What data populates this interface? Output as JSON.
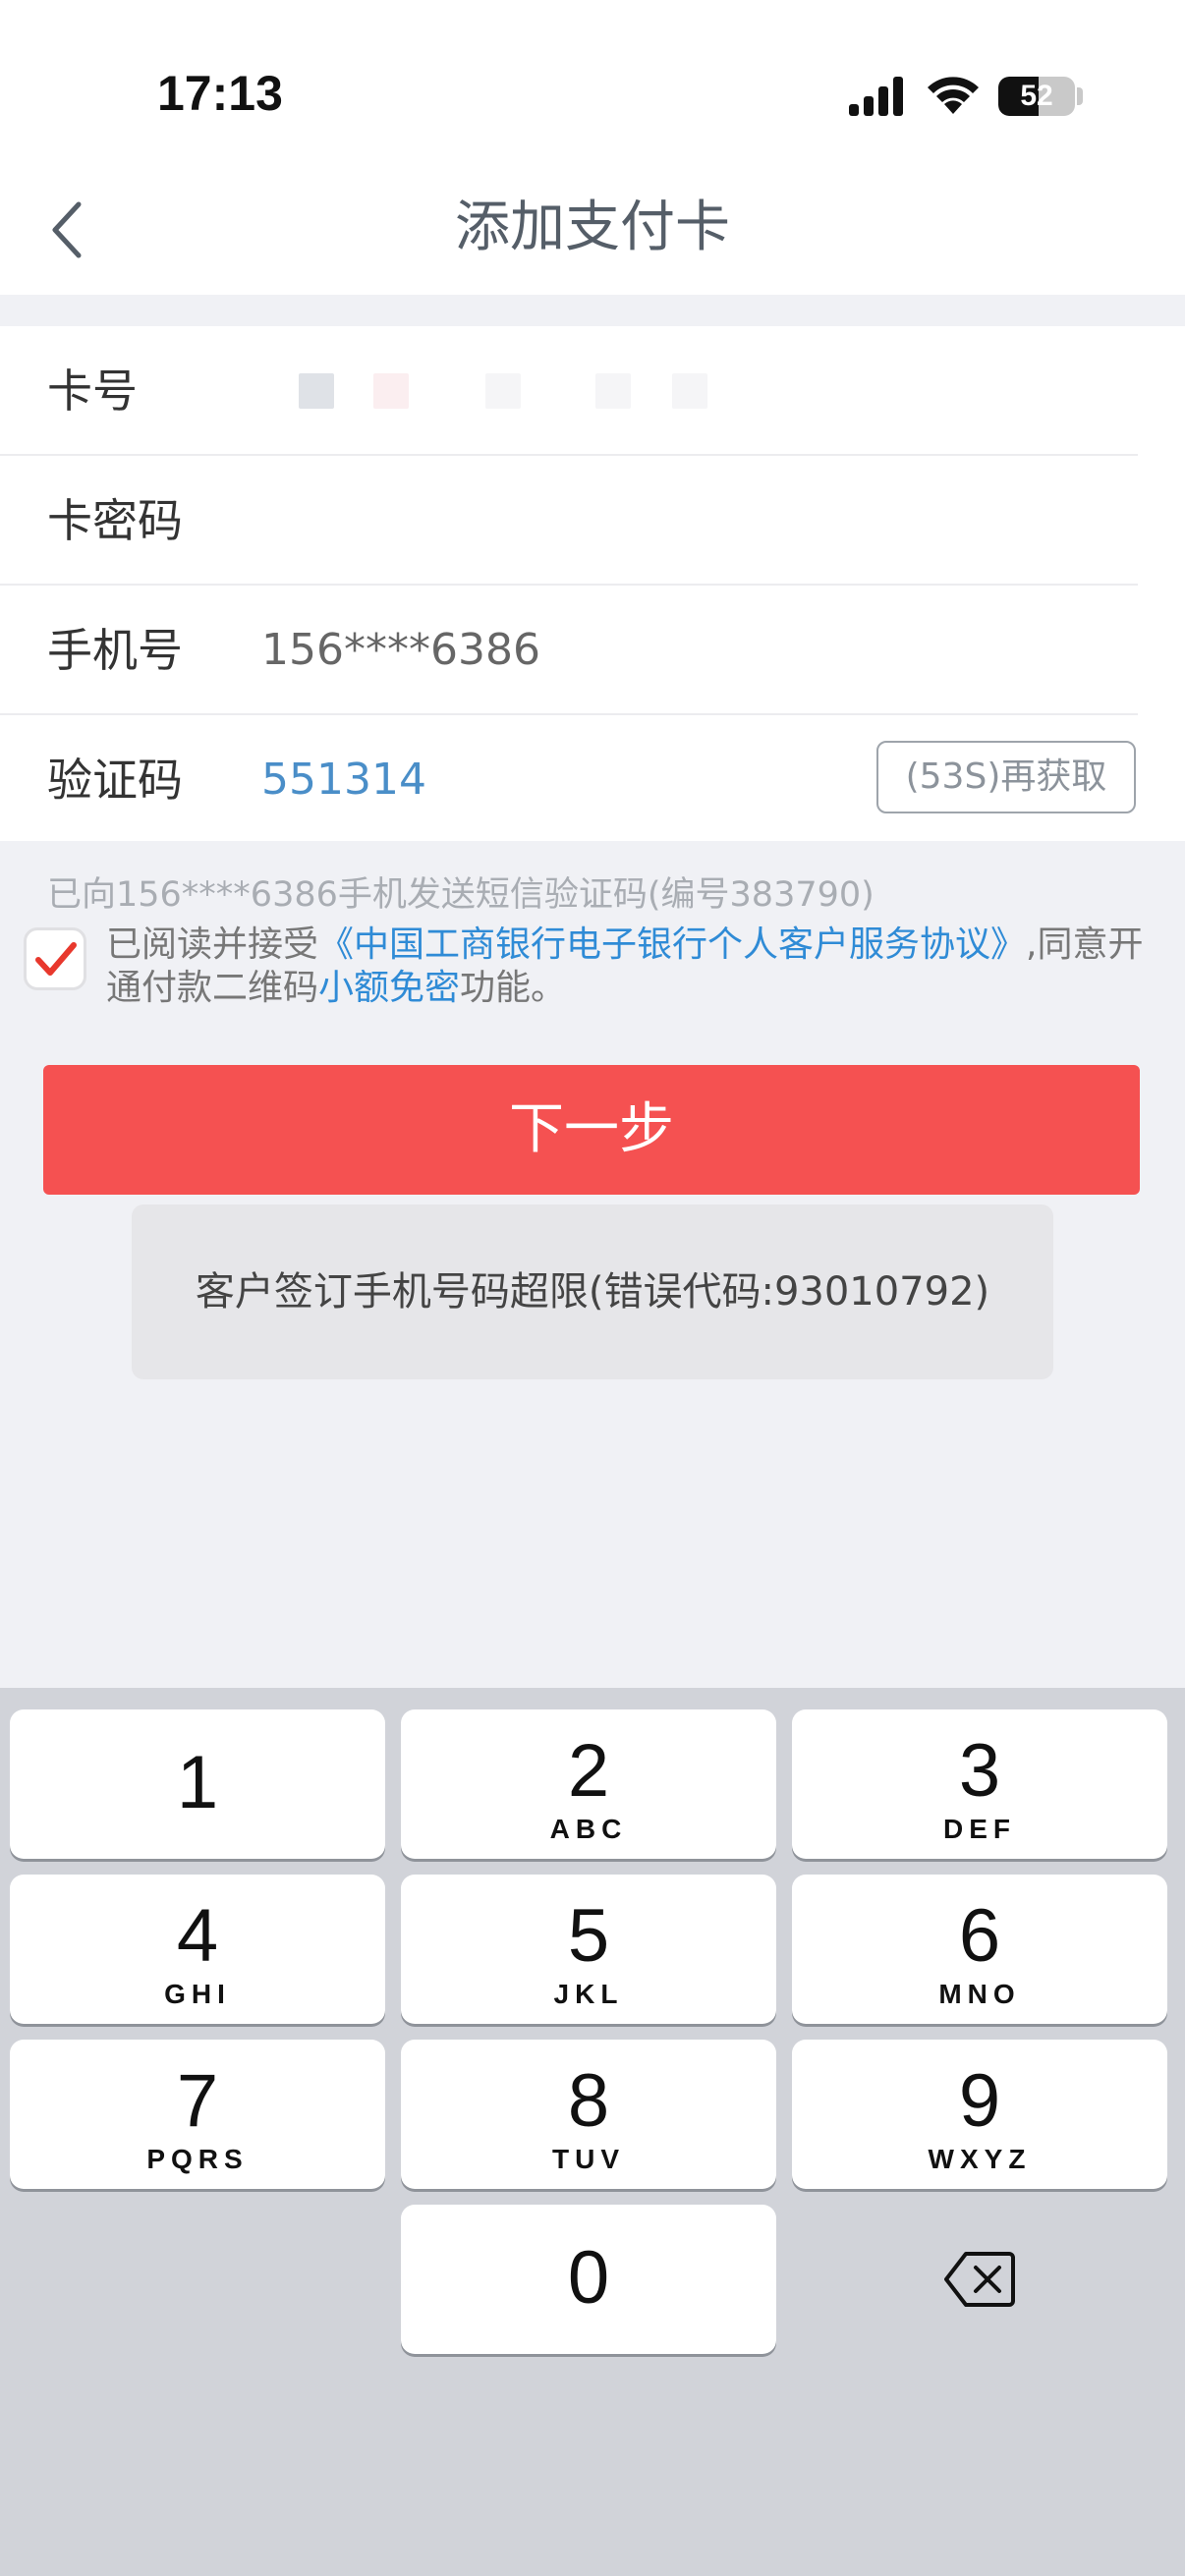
{
  "status_bar": {
    "time": "17:13",
    "battery": "52",
    "battery_percent": 52
  },
  "nav": {
    "title": "添加支付卡",
    "back_icon": "chevron-left-icon"
  },
  "form": {
    "card_number_label": "卡号",
    "card_password_label": "卡密码",
    "phone_label": "手机号",
    "phone_value": "156****6386",
    "code_label": "验证码",
    "code_value": "551314",
    "resend_label": "(53S)再获取"
  },
  "sms_note": "已向156****6386手机发送短信验证码(编号383790)",
  "agreement": {
    "checked": true,
    "prefix": "已阅读并接受",
    "link1": "《中国工商银行电子银行个人客户服务协议》",
    "middle": ",同意开通付款二维码",
    "link2": "小额免密",
    "suffix": "功能。"
  },
  "next_button": "下一步",
  "toast": "客户签订手机号码超限(错误代码:93010792)",
  "keyboard": {
    "keys": [
      {
        "digit": "1",
        "letters": ""
      },
      {
        "digit": "2",
        "letters": "ABC"
      },
      {
        "digit": "3",
        "letters": "DEF"
      },
      {
        "digit": "4",
        "letters": "GHI"
      },
      {
        "digit": "5",
        "letters": "JKL"
      },
      {
        "digit": "6",
        "letters": "MNO"
      },
      {
        "digit": "7",
        "letters": "PQRS"
      },
      {
        "digit": "8",
        "letters": "TUV"
      },
      {
        "digit": "9",
        "letters": "WXYZ"
      },
      {
        "digit": "0",
        "letters": ""
      }
    ],
    "backspace_icon": "backspace-icon"
  },
  "colors": {
    "accent_red": "#f55151",
    "link_blue": "#2f8bd6",
    "code_blue": "#4a8ec8"
  }
}
